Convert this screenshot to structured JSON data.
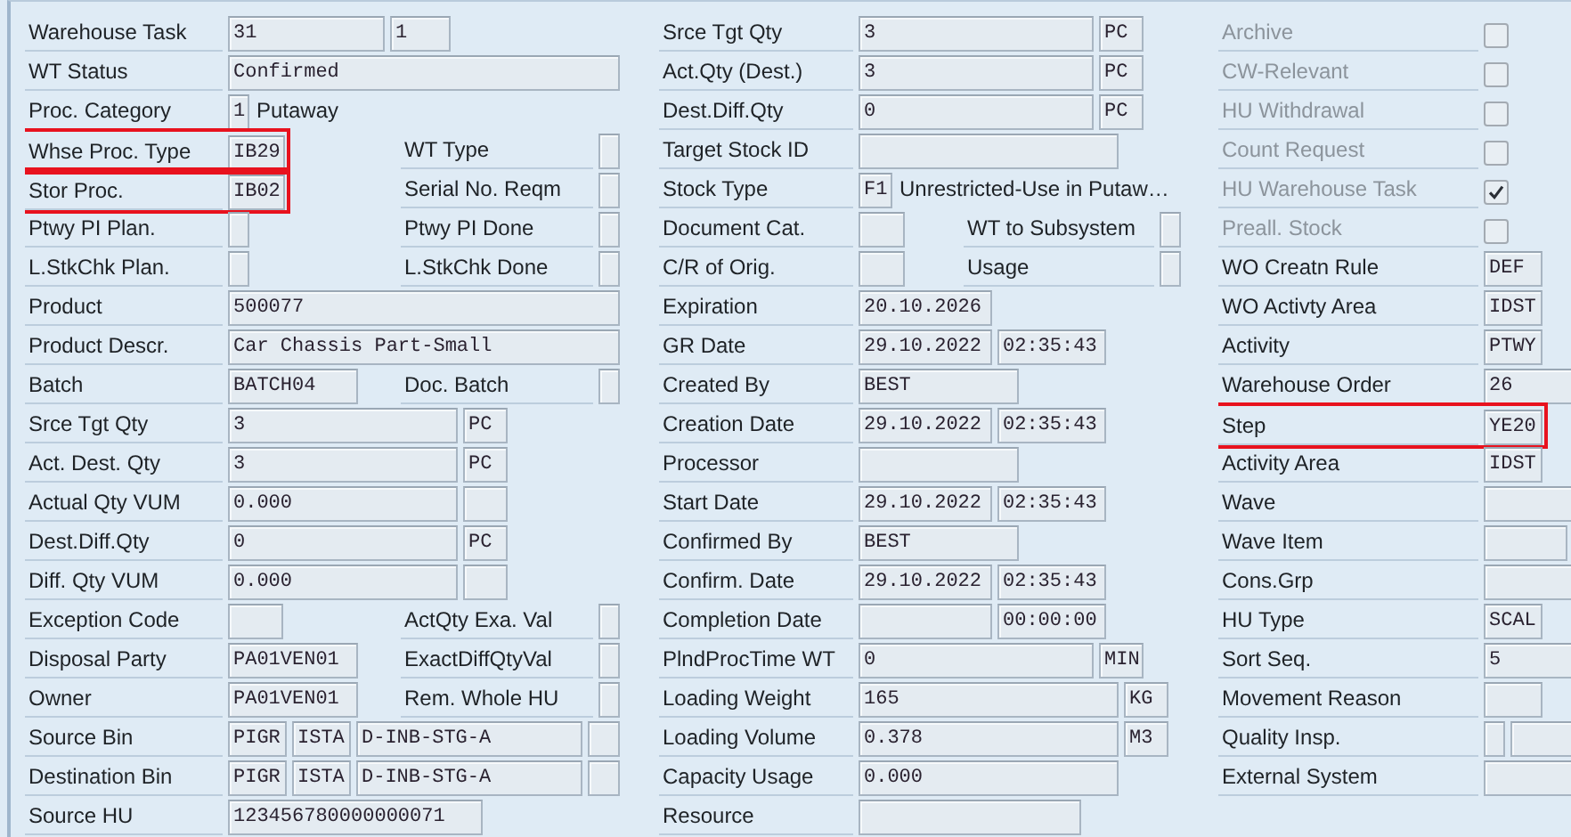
{
  "columns": [
    {
      "rows": [
        {
          "label": "Warehouse Task",
          "highlighted": false,
          "items": [
            {
              "kind": "field",
              "value": "31"
            },
            {
              "kind": "field",
              "value": "1"
            }
          ]
        },
        {
          "label": "WT Status",
          "highlighted": false,
          "items": [
            {
              "kind": "field",
              "value": "Confirmed"
            }
          ]
        },
        {
          "label": "Proc. Category",
          "highlighted": false,
          "items": [
            {
              "kind": "field",
              "value": "1"
            },
            {
              "kind": "text",
              "value": "Putaway"
            }
          ]
        },
        {
          "label": "Whse Proc. Type",
          "highlighted": true,
          "items": [
            {
              "kind": "field",
              "value": "IB29"
            },
            {
              "kind": "label",
              "text": "WT Type"
            },
            {
              "kind": "field"
            }
          ]
        },
        {
          "label": "Stor Proc.",
          "highlighted": true,
          "items": [
            {
              "kind": "field",
              "value": "IB02"
            },
            {
              "kind": "label",
              "text": "Serial No. Reqm"
            },
            {
              "kind": "field"
            }
          ]
        },
        {
          "label": "Ptwy PI Plan.",
          "highlighted": false,
          "items": [
            {
              "kind": "field"
            },
            {
              "kind": "label",
              "text": "Ptwy PI Done"
            },
            {
              "kind": "field"
            }
          ]
        },
        {
          "label": "L.StkChk Plan.",
          "highlighted": false,
          "items": [
            {
              "kind": "field"
            },
            {
              "kind": "label",
              "text": "L.StkChk Done"
            },
            {
              "kind": "field"
            }
          ]
        },
        {
          "label": "Product",
          "highlighted": false,
          "items": [
            {
              "kind": "field",
              "value": "500077"
            }
          ]
        },
        {
          "label": "Product Descr.",
          "highlighted": false,
          "items": [
            {
              "kind": "field",
              "value": "Car Chassis Part-Small"
            }
          ]
        },
        {
          "label": "Batch",
          "highlighted": false,
          "items": [
            {
              "kind": "field",
              "value": "BATCH04"
            },
            {
              "kind": "label",
              "text": "Doc. Batch"
            },
            {
              "kind": "field"
            }
          ]
        },
        {
          "label": "Srce Tgt Qty",
          "highlighted": false,
          "items": [
            {
              "kind": "field",
              "value": "3"
            },
            {
              "kind": "field",
              "value": "PC"
            }
          ]
        },
        {
          "label": "Act. Dest. Qty",
          "highlighted": false,
          "items": [
            {
              "kind": "field",
              "value": "3"
            },
            {
              "kind": "field",
              "value": "PC"
            }
          ]
        },
        {
          "label": "Actual Qty VUM",
          "highlighted": false,
          "items": [
            {
              "kind": "field",
              "value": "0.000"
            },
            {
              "kind": "field"
            }
          ]
        },
        {
          "label": "Dest.Diff.Qty",
          "highlighted": false,
          "items": [
            {
              "kind": "field",
              "value": "0"
            },
            {
              "kind": "field",
              "value": "PC"
            }
          ]
        },
        {
          "label": "Diff. Qty VUM",
          "highlighted": false,
          "items": [
            {
              "kind": "field",
              "value": "0.000"
            },
            {
              "kind": "field"
            }
          ]
        },
        {
          "label": "Exception Code",
          "highlighted": false,
          "items": [
            {
              "kind": "field"
            },
            {
              "kind": "label",
              "text": "ActQty Exa. Val"
            },
            {
              "kind": "field"
            }
          ]
        },
        {
          "label": "Disposal Party",
          "highlighted": false,
          "items": [
            {
              "kind": "field",
              "value": "PA01VEN01"
            },
            {
              "kind": "label",
              "text": "ExactDiffQtyVal"
            },
            {
              "kind": "field"
            }
          ]
        },
        {
          "label": "Owner",
          "highlighted": false,
          "items": [
            {
              "kind": "field",
              "value": "PA01VEN01"
            },
            {
              "kind": "label",
              "text": "Rem. Whole HU"
            },
            {
              "kind": "field"
            }
          ]
        },
        {
          "label": "Source Bin",
          "highlighted": false,
          "items": [
            {
              "kind": "field",
              "value": "PIGR"
            },
            {
              "kind": "field",
              "value": "ISTA"
            },
            {
              "kind": "field",
              "value": "D-INB-STG-A"
            },
            {
              "kind": "field"
            }
          ]
        },
        {
          "label": "Destination Bin",
          "highlighted": false,
          "items": [
            {
              "kind": "field",
              "value": "PIGR"
            },
            {
              "kind": "field",
              "value": "ISTA"
            },
            {
              "kind": "field",
              "value": "D-INB-STG-A"
            },
            {
              "kind": "field"
            }
          ]
        },
        {
          "label": "Source HU",
          "highlighted": false,
          "items": [
            {
              "kind": "field",
              "value": "123456780000000071"
            }
          ]
        }
      ]
    },
    {
      "rows": [
        {
          "label": "Srce Tgt Qty",
          "highlighted": false,
          "items": [
            {
              "kind": "field",
              "value": "3"
            },
            {
              "kind": "field",
              "value": "PC"
            }
          ]
        },
        {
          "label": "Act.Qty (Dest.)",
          "highlighted": false,
          "items": [
            {
              "kind": "field",
              "value": "3"
            },
            {
              "kind": "field",
              "value": "PC"
            }
          ]
        },
        {
          "label": "Dest.Diff.Qty",
          "highlighted": false,
          "items": [
            {
              "kind": "field",
              "value": "0"
            },
            {
              "kind": "field",
              "value": "PC"
            }
          ]
        },
        {
          "label": "Target Stock ID",
          "highlighted": false,
          "items": [
            {
              "kind": "field"
            }
          ]
        },
        {
          "label": "Stock Type",
          "highlighted": false,
          "items": [
            {
              "kind": "field",
              "value": "F1"
            },
            {
              "kind": "text",
              "value": "Unrestricted-Use in Putaw…"
            }
          ]
        },
        {
          "label": "Document Cat.",
          "highlighted": false,
          "items": [
            {
              "kind": "field"
            },
            {
              "kind": "label",
              "text": "WT to Subsystem"
            },
            {
              "kind": "field"
            }
          ]
        },
        {
          "label": "C/R of Orig.",
          "highlighted": false,
          "items": [
            {
              "kind": "field"
            },
            {
              "kind": "label",
              "text": "Usage"
            },
            {
              "kind": "field"
            }
          ]
        },
        {
          "label": "Expiration",
          "highlighted": false,
          "items": [
            {
              "kind": "field",
              "value": "20.10.2026"
            }
          ]
        },
        {
          "label": "GR Date",
          "highlighted": false,
          "items": [
            {
              "kind": "field",
              "value": "29.10.2022"
            },
            {
              "kind": "field",
              "value": "02:35:43"
            }
          ]
        },
        {
          "label": "Created By",
          "highlighted": false,
          "items": [
            {
              "kind": "field",
              "value": "BEST"
            }
          ]
        },
        {
          "label": "Creation Date",
          "highlighted": false,
          "items": [
            {
              "kind": "field",
              "value": "29.10.2022"
            },
            {
              "kind": "field",
              "value": "02:35:43"
            }
          ]
        },
        {
          "label": "Processor",
          "highlighted": false,
          "items": [
            {
              "kind": "field"
            }
          ]
        },
        {
          "label": "Start Date",
          "highlighted": false,
          "items": [
            {
              "kind": "field",
              "value": "29.10.2022"
            },
            {
              "kind": "field",
              "value": "02:35:43"
            }
          ]
        },
        {
          "label": "Confirmed By",
          "highlighted": false,
          "items": [
            {
              "kind": "field",
              "value": "BEST"
            }
          ]
        },
        {
          "label": "Confirm. Date",
          "highlighted": false,
          "items": [
            {
              "kind": "field",
              "value": "29.10.2022"
            },
            {
              "kind": "field",
              "value": "02:35:43"
            }
          ]
        },
        {
          "label": "Completion Date",
          "highlighted": false,
          "items": [
            {
              "kind": "field"
            },
            {
              "kind": "field",
              "value": "00:00:00"
            }
          ]
        },
        {
          "label": "PlndProcTime WT",
          "highlighted": false,
          "items": [
            {
              "kind": "field",
              "value": "0"
            },
            {
              "kind": "field",
              "value": "MIN"
            }
          ]
        },
        {
          "label": "Loading Weight",
          "highlighted": false,
          "items": [
            {
              "kind": "field",
              "value": "165"
            },
            {
              "kind": "field",
              "value": "KG"
            }
          ]
        },
        {
          "label": "Loading Volume",
          "highlighted": false,
          "items": [
            {
              "kind": "field",
              "value": "0.378"
            },
            {
              "kind": "field",
              "value": "M3"
            }
          ]
        },
        {
          "label": "Capacity Usage",
          "highlighted": false,
          "items": [
            {
              "kind": "field",
              "value": "0.000"
            }
          ]
        },
        {
          "label": "Resource",
          "highlighted": false,
          "items": [
            {
              "kind": "field"
            }
          ]
        }
      ]
    },
    {
      "rows": [
        {
          "label": "Archive",
          "highlighted": false,
          "disabled": true,
          "items": [
            {
              "kind": "checkbox",
              "checked": false
            }
          ]
        },
        {
          "label": "CW-Relevant",
          "highlighted": false,
          "disabled": true,
          "items": [
            {
              "kind": "checkbox",
              "checked": false
            }
          ]
        },
        {
          "label": "HU Withdrawal",
          "highlighted": false,
          "disabled": true,
          "items": [
            {
              "kind": "checkbox",
              "checked": false
            }
          ]
        },
        {
          "label": "Count Request",
          "highlighted": false,
          "disabled": true,
          "items": [
            {
              "kind": "checkbox",
              "checked": false
            }
          ]
        },
        {
          "label": "HU Warehouse Task",
          "highlighted": false,
          "disabled": true,
          "items": [
            {
              "kind": "checkbox",
              "checked": true
            }
          ]
        },
        {
          "label": "Preall. Stock",
          "highlighted": false,
          "disabled": true,
          "items": [
            {
              "kind": "checkbox",
              "checked": false
            }
          ]
        },
        {
          "label": "WO Creatn Rule",
          "highlighted": false,
          "disabled": false,
          "items": [
            {
              "kind": "field",
              "value": "DEF"
            }
          ]
        },
        {
          "label": "WO Activty Area",
          "highlighted": false,
          "disabled": false,
          "items": [
            {
              "kind": "field",
              "value": "IDST"
            }
          ]
        },
        {
          "label": "Activity",
          "highlighted": false,
          "disabled": false,
          "items": [
            {
              "kind": "field",
              "value": "PTWY"
            }
          ]
        },
        {
          "label": "Warehouse Order",
          "highlighted": false,
          "disabled": false,
          "items": [
            {
              "kind": "field",
              "value": "26"
            }
          ]
        },
        {
          "label": "Step",
          "highlighted": true,
          "disabled": false,
          "items": [
            {
              "kind": "field",
              "value": "YE20"
            }
          ]
        },
        {
          "label": "Activity Area",
          "highlighted": false,
          "disabled": false,
          "items": [
            {
              "kind": "field",
              "value": "IDST"
            }
          ]
        },
        {
          "label": "Wave",
          "highlighted": false,
          "disabled": false,
          "items": [
            {
              "kind": "field"
            }
          ]
        },
        {
          "label": "Wave Item",
          "highlighted": false,
          "disabled": false,
          "items": [
            {
              "kind": "field"
            }
          ]
        },
        {
          "label": "Cons.Grp",
          "highlighted": false,
          "disabled": false,
          "items": [
            {
              "kind": "field"
            }
          ]
        },
        {
          "label": "HU Type",
          "highlighted": false,
          "disabled": false,
          "items": [
            {
              "kind": "field",
              "value": "SCAL"
            }
          ]
        },
        {
          "label": "Sort Seq.",
          "highlighted": false,
          "disabled": false,
          "items": [
            {
              "kind": "field",
              "value": "5"
            }
          ]
        },
        {
          "label": "Movement Reason",
          "highlighted": false,
          "disabled": false,
          "items": [
            {
              "kind": "field"
            }
          ]
        },
        {
          "label": "Quality Insp.",
          "highlighted": false,
          "disabled": false,
          "items": [
            {
              "kind": "field"
            },
            {
              "kind": "field"
            }
          ]
        },
        {
          "label": "External System",
          "highlighted": false,
          "disabled": false,
          "items": [
            {
              "kind": "field"
            }
          ]
        }
      ]
    }
  ]
}
